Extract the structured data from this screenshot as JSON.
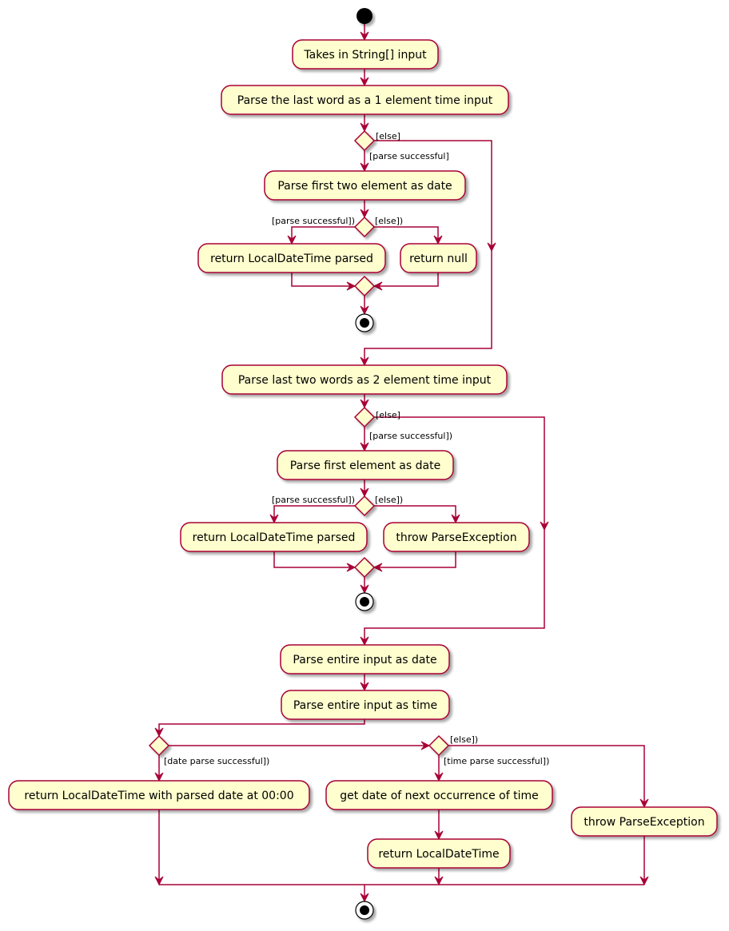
{
  "diagram": {
    "type": "activity",
    "colors": {
      "activity_fill": "#FEFECE",
      "border": "#A80036",
      "node": "#000000"
    },
    "activities": [
      {
        "id": "a1",
        "label": "Takes in String[] input"
      },
      {
        "id": "a2",
        "label": "Parse the last word as a 1 element time input"
      },
      {
        "id": "a3",
        "label": "Parse first two element as date"
      },
      {
        "id": "a4",
        "label": "return LocalDateTime parsed"
      },
      {
        "id": "a5",
        "label": "return null"
      },
      {
        "id": "a6",
        "label": "Parse last two words as 2 element time input"
      },
      {
        "id": "a7",
        "label": "Parse first element as date"
      },
      {
        "id": "a8",
        "label": "return LocalDateTime parsed"
      },
      {
        "id": "a9",
        "label": "throw ParseException"
      },
      {
        "id": "a10",
        "label": "Parse entire input as date"
      },
      {
        "id": "a11",
        "label": "Parse entire input as time"
      },
      {
        "id": "a12",
        "label": "return LocalDateTime with parsed date at 00:00"
      },
      {
        "id": "a13",
        "label": "get date of next occurrence of time"
      },
      {
        "id": "a14",
        "label": "return LocalDateTime"
      },
      {
        "id": "a15",
        "label": "throw ParseException"
      }
    ],
    "guards": [
      {
        "id": "g1",
        "label": "[else]"
      },
      {
        "id": "g2",
        "label": "[parse successful]"
      },
      {
        "id": "g3",
        "label": "[parse successful])"
      },
      {
        "id": "g4",
        "label": "[else])"
      },
      {
        "id": "g5",
        "label": "[else]"
      },
      {
        "id": "g6",
        "label": "[parse successful])"
      },
      {
        "id": "g7",
        "label": "[parse successful])"
      },
      {
        "id": "g8",
        "label": "[else])"
      },
      {
        "id": "g9",
        "label": "[date parse successful])"
      },
      {
        "id": "g10",
        "label": "[else])"
      },
      {
        "id": "g11",
        "label": "[time parse successful])"
      }
    ]
  }
}
